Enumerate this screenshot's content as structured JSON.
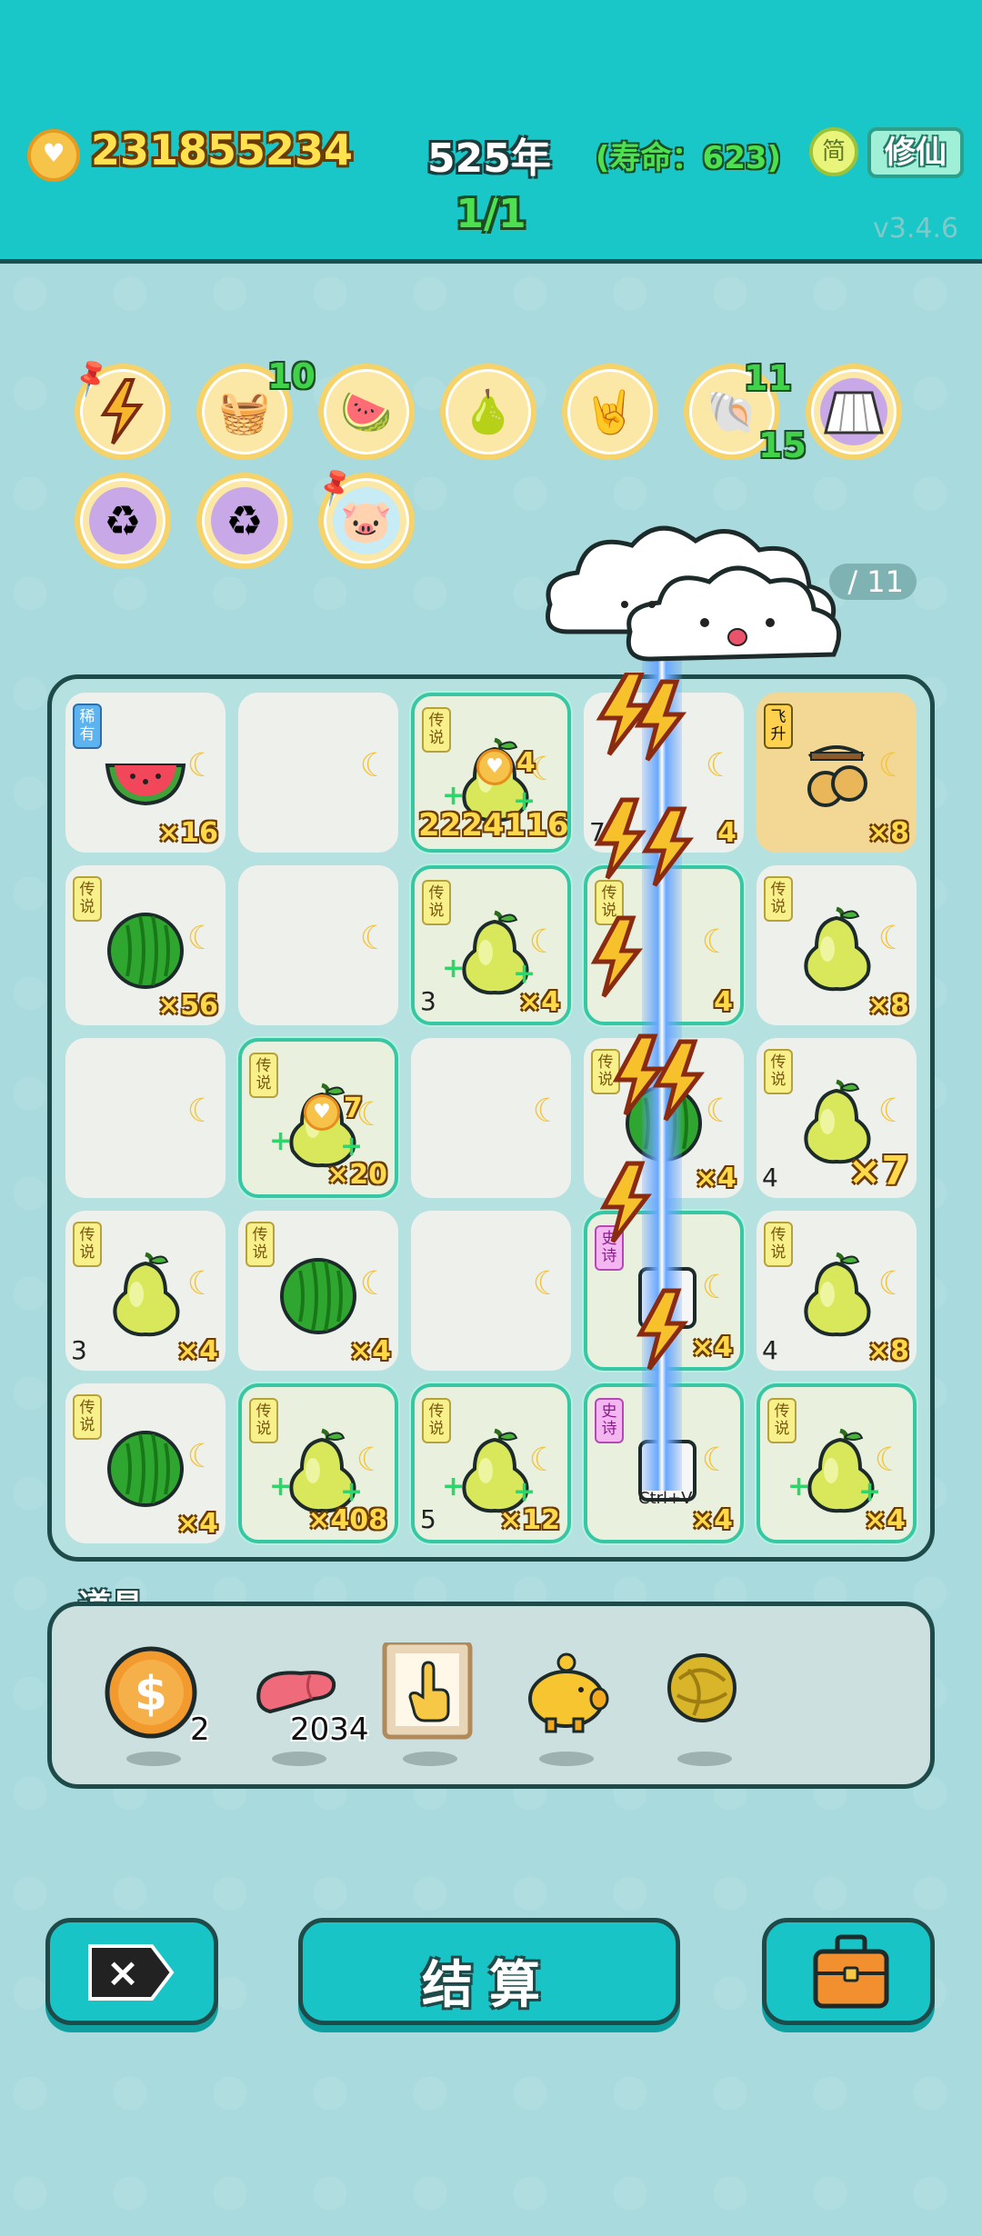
{
  "header": {
    "coins": "231855234",
    "year": "525年",
    "lifespan": "(寿命：623)",
    "lang_label": "简",
    "cultivate_label": "修仙",
    "round": "1/1",
    "version": "v3.4.6"
  },
  "skills": [
    {
      "name": "lightning",
      "badge": ""
    },
    {
      "name": "fruit-basket",
      "badge": "10"
    },
    {
      "name": "fruit-bowl",
      "badge": ""
    },
    {
      "name": "pomelo",
      "badge": ""
    },
    {
      "name": "rock-hand",
      "badge": ""
    },
    {
      "name": "shell",
      "badge_top": "11",
      "badge_bottom": "15"
    },
    {
      "name": "skirt",
      "badge": ""
    },
    {
      "name": "recycle",
      "badge": ""
    },
    {
      "name": "recycle",
      "badge": ""
    },
    {
      "name": "piggy",
      "badge": ""
    }
  ],
  "progress_text": "/ 11",
  "board": {
    "rows": [
      [
        {
          "fruit": "watermelon-slice",
          "tag": "稀有",
          "mult": "×16"
        },
        {
          "fruit": "",
          "tag": "",
          "mult": ""
        },
        {
          "fruit": "pomelo",
          "tag": "传说",
          "mult": "",
          "heart": "4",
          "value": "2224116",
          "selected": true
        },
        {
          "fruit": "",
          "tag": "",
          "mult": "4",
          "level": "7"
        },
        {
          "fruit": "cherry",
          "tag": "飞升",
          "mult": "×8",
          "gold": true
        }
      ],
      [
        {
          "fruit": "watermelon",
          "tag": "传说",
          "mult": "×56"
        },
        {
          "fruit": "",
          "tag": "",
          "mult": ""
        },
        {
          "fruit": "pomelo",
          "tag": "传说",
          "mult": "×4",
          "level": "3",
          "selected": true
        },
        {
          "fruit": "",
          "tag": "传说",
          "mult": "4",
          "selected": true
        },
        {
          "fruit": "pomelo",
          "tag": "传说",
          "mult": "×8"
        }
      ],
      [
        {
          "fruit": "",
          "tag": "",
          "mult": ""
        },
        {
          "fruit": "pomelo",
          "tag": "传说",
          "mult": "×20",
          "heart": "7",
          "selected": true
        },
        {
          "fruit": "",
          "tag": "",
          "mult": ""
        },
        {
          "fruit": "watermelon",
          "tag": "传说",
          "mult": "×4"
        },
        {
          "fruit": "pomelo",
          "tag": "传说",
          "mult": "×7",
          "level": "4",
          "big": true
        }
      ],
      [
        {
          "fruit": "pomelo",
          "tag": "传说",
          "mult": "×4",
          "level": "3"
        },
        {
          "fruit": "watermelon",
          "tag": "传说",
          "mult": "×4"
        },
        {
          "fruit": "",
          "tag": "",
          "mult": ""
        },
        {
          "fruit": "keyboard",
          "tag": "史诗",
          "mult": "×4",
          "selected": true
        },
        {
          "fruit": "pomelo",
          "tag": "传说",
          "mult": "×8",
          "level": "4"
        }
      ],
      [
        {
          "fruit": "watermelon",
          "tag": "传说",
          "mult": "×4"
        },
        {
          "fruit": "pomelo",
          "tag": "传说",
          "mult": "×408",
          "selected": true
        },
        {
          "fruit": "pomelo",
          "tag": "传说",
          "mult": "×12",
          "level": "5",
          "selected": true
        },
        {
          "fruit": "ctrl-v",
          "tag": "史诗",
          "mult": "×4",
          "caption": "Ctrl+V",
          "selected": true
        },
        {
          "fruit": "pomelo",
          "tag": "传说",
          "mult": "×4",
          "selected": true
        }
      ]
    ]
  },
  "props": {
    "label": "道具",
    "items": [
      {
        "name": "dollar-coin",
        "count": "2"
      },
      {
        "name": "liver",
        "count": "2034"
      },
      {
        "name": "hand-card",
        "count": ""
      },
      {
        "name": "golden-piggy",
        "count": ""
      },
      {
        "name": "gold-ball",
        "count": ""
      }
    ]
  },
  "buttons": {
    "quit": "×",
    "settle": "结算",
    "bag": "bag"
  },
  "colors": {
    "header": "#19c7c8",
    "background": "#a9dadd",
    "gold_text": "#ffd94a",
    "green_text": "#4de051"
  }
}
